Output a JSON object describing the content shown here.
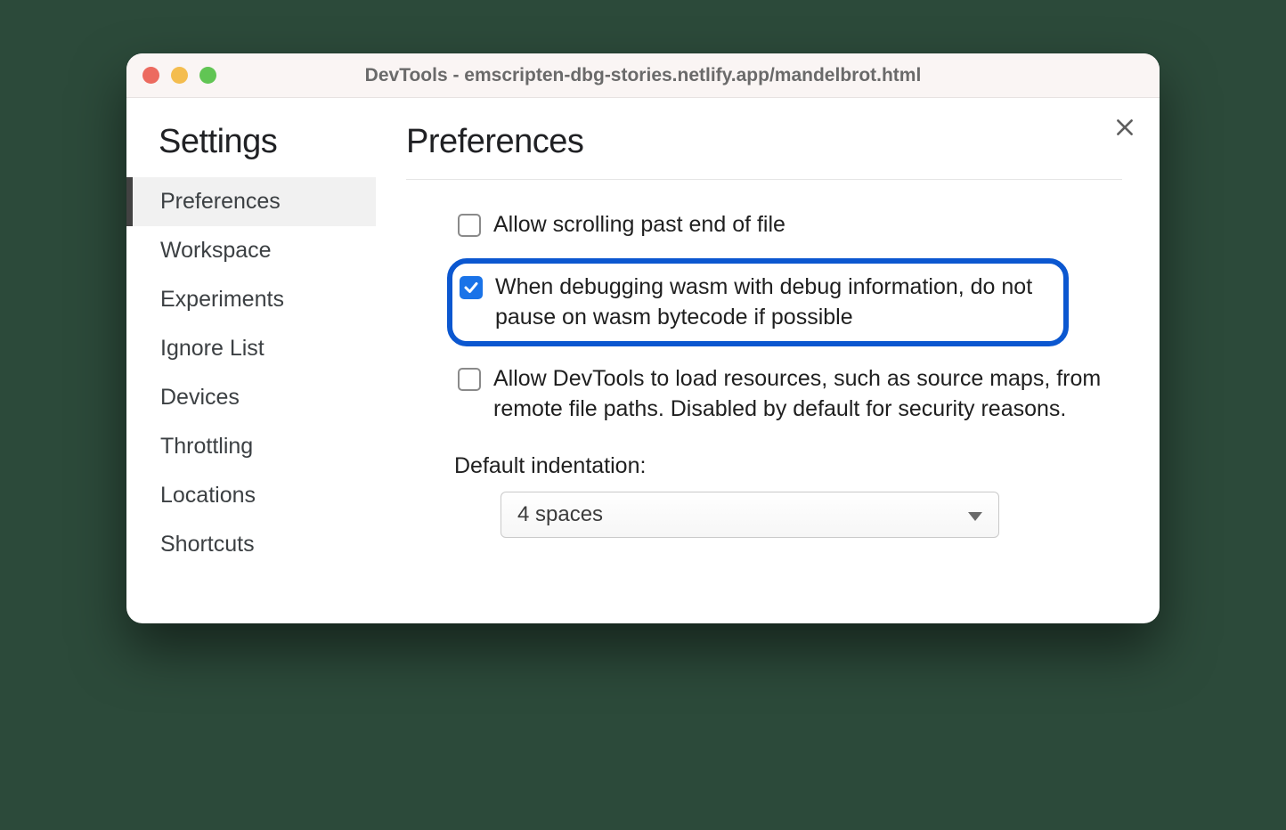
{
  "window": {
    "title": "DevTools - emscripten-dbg-stories.netlify.app/mandelbrot.html"
  },
  "sidebar": {
    "title": "Settings",
    "items": [
      {
        "label": "Preferences",
        "active": true
      },
      {
        "label": "Workspace",
        "active": false
      },
      {
        "label": "Experiments",
        "active": false
      },
      {
        "label": "Ignore List",
        "active": false
      },
      {
        "label": "Devices",
        "active": false
      },
      {
        "label": "Throttling",
        "active": false
      },
      {
        "label": "Locations",
        "active": false
      },
      {
        "label": "Shortcuts",
        "active": false
      }
    ]
  },
  "main": {
    "title": "Preferences",
    "checkboxes": [
      {
        "label": "Allow scrolling past end of file",
        "checked": false,
        "highlight": false
      },
      {
        "label": "When debugging wasm with debug information, do not pause on wasm bytecode if possible",
        "checked": true,
        "highlight": true
      },
      {
        "label": "Allow DevTools to load resources, such as source maps, from remote file paths. Disabled by default for security reasons.",
        "checked": false,
        "highlight": false
      }
    ],
    "indentation": {
      "label": "Default indentation:",
      "selected": "4 spaces"
    }
  }
}
